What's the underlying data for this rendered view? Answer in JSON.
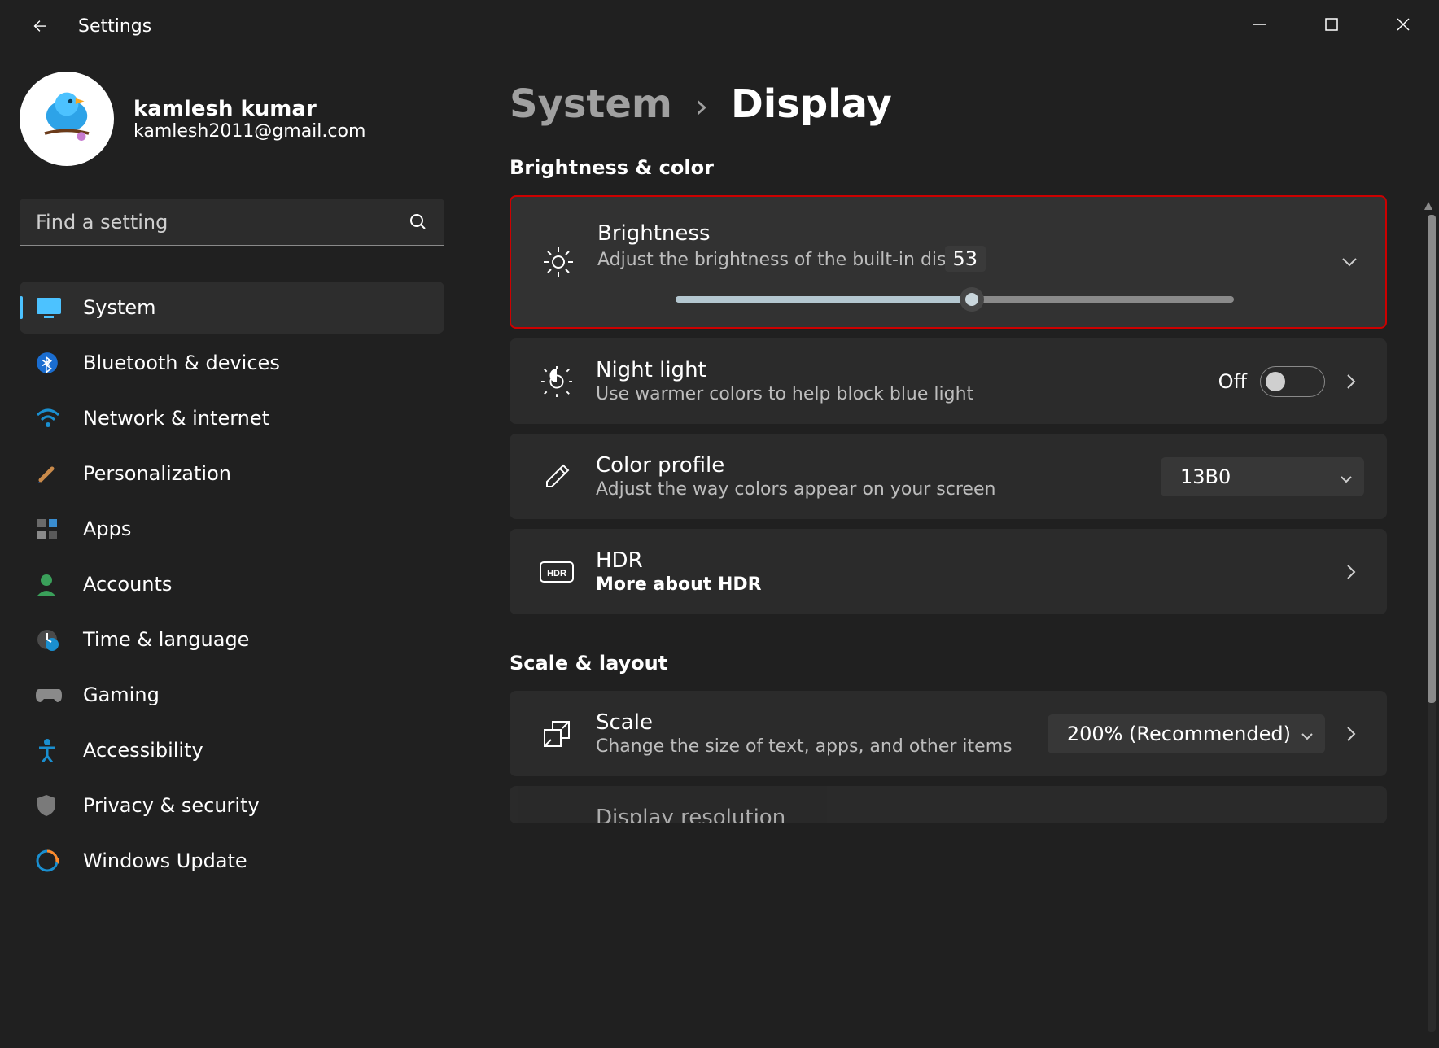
{
  "app": {
    "title": "Settings"
  },
  "profile": {
    "name": "kamlesh kumar",
    "email": "kamlesh2011@gmail.com"
  },
  "search": {
    "placeholder": "Find a setting"
  },
  "nav": {
    "items": [
      {
        "label": "System",
        "active": true
      },
      {
        "label": "Bluetooth & devices"
      },
      {
        "label": "Network & internet"
      },
      {
        "label": "Personalization"
      },
      {
        "label": "Apps"
      },
      {
        "label": "Accounts"
      },
      {
        "label": "Time & language"
      },
      {
        "label": "Gaming"
      },
      {
        "label": "Accessibility"
      },
      {
        "label": "Privacy & security"
      },
      {
        "label": "Windows Update"
      }
    ]
  },
  "breadcrumb": {
    "parent": "System",
    "current": "Display"
  },
  "sections": {
    "brightness_color": {
      "title": "Brightness & color",
      "brightness": {
        "title": "Brightness",
        "sub": "Adjust the brightness of the built-in dis",
        "value": "53"
      },
      "night_light": {
        "title": "Night light",
        "sub": "Use warmer colors to help block blue light",
        "state_label": "Off"
      },
      "color_profile": {
        "title": "Color profile",
        "sub": "Adjust the way colors appear on your screen",
        "selected": "13B0"
      },
      "hdr": {
        "title": "HDR",
        "sub": "More about HDR"
      }
    },
    "scale_layout": {
      "title": "Scale & layout",
      "scale": {
        "title": "Scale",
        "sub": "Change the size of text, apps, and other items",
        "selected": "200% (Recommended)"
      },
      "display_resolution": {
        "title": "Display resolution"
      }
    }
  }
}
